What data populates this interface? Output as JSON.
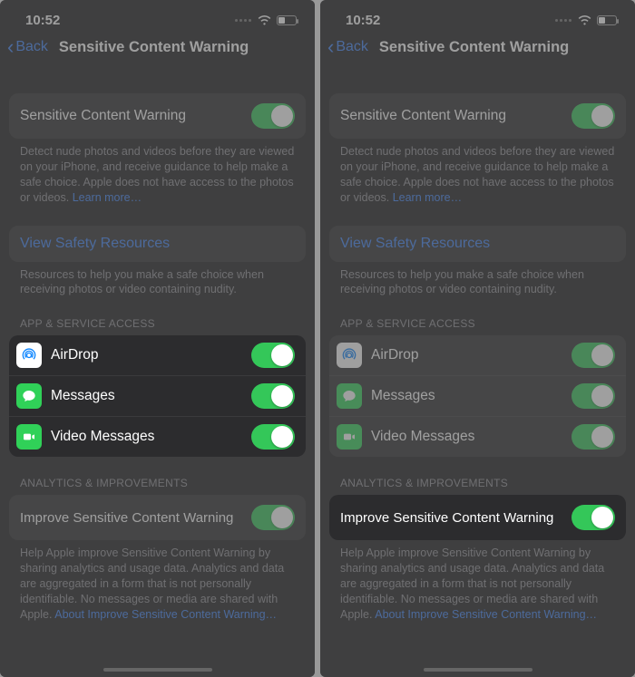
{
  "status": {
    "time": "10:52"
  },
  "nav": {
    "back": "Back",
    "title": "Sensitive Content Warning"
  },
  "main": {
    "toggle_label": "Sensitive Content Warning",
    "desc": "Detect nude photos and videos before they are viewed on your iPhone, and receive guidance to help make a safe choice. Apple does not have access to the photos or videos.",
    "learn_more": "Learn more…"
  },
  "safety": {
    "link": "View Safety Resources",
    "desc": "Resources to help you make a safe choice when receiving photos or video containing nudity."
  },
  "apps": {
    "header": "APP & SERVICE ACCESS",
    "items": [
      {
        "label": "AirDrop"
      },
      {
        "label": "Messages"
      },
      {
        "label": "Video Messages"
      }
    ]
  },
  "analytics": {
    "header": "ANALYTICS & IMPROVEMENTS",
    "toggle_label": "Improve Sensitive Content Warning",
    "desc": "Help Apple improve Sensitive Content Warning by sharing analytics and usage data. Analytics and data are aggregated in a form that is not personally identifiable. No messages or media are shared with Apple.",
    "about_link": "About Improve Sensitive Content Warning…"
  }
}
